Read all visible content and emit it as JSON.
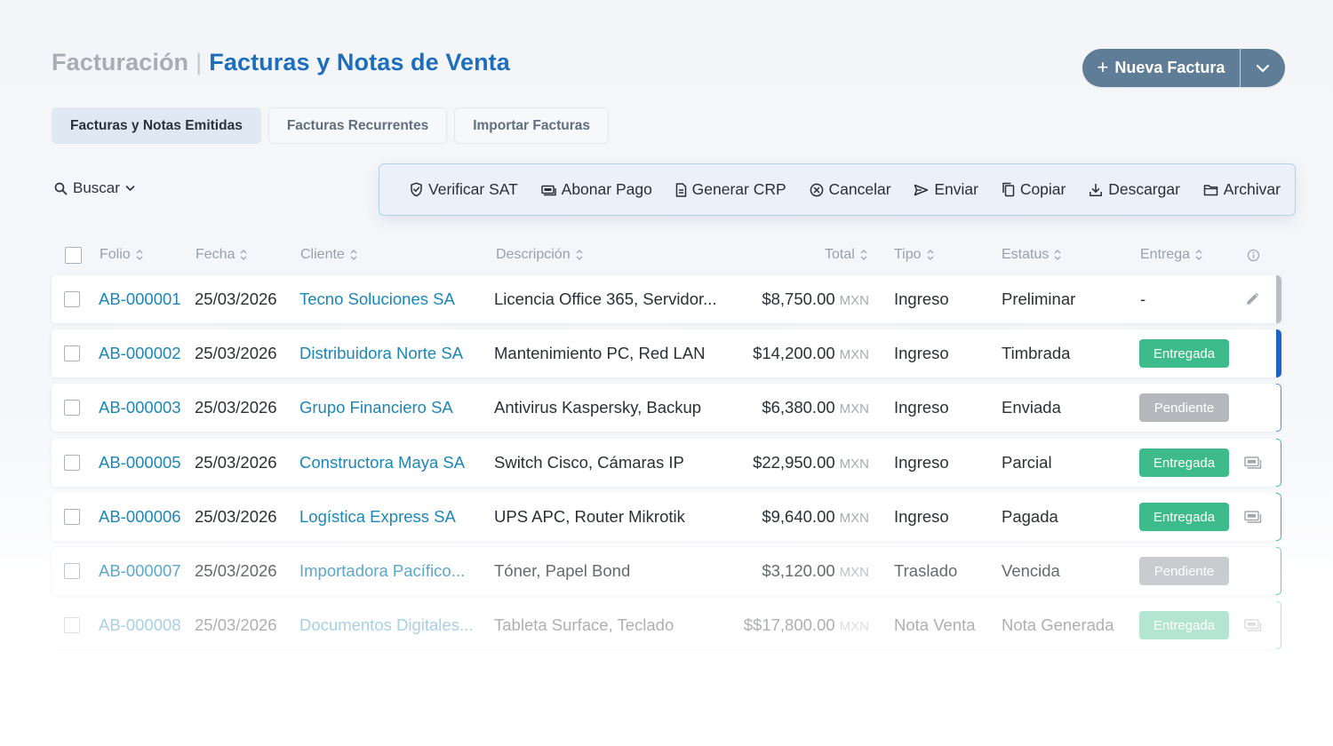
{
  "header": {
    "crumb": "Facturación",
    "separator": "|",
    "title": "Facturas y Notas de Venta",
    "new_button": "Nueva Factura",
    "new_button_icon": "plus-icon",
    "dropdown_icon": "chevron-down-icon"
  },
  "tabs": [
    {
      "label": "Facturas y Notas Emitidas",
      "active": true
    },
    {
      "label": "Facturas Recurrentes",
      "active": false
    },
    {
      "label": "Importar Facturas",
      "active": false
    }
  ],
  "search": {
    "label": "Buscar"
  },
  "toolbar": [
    {
      "label": "Verificar SAT",
      "icon": "shield-check-icon"
    },
    {
      "label": "Abonar Pago",
      "icon": "payment-icon"
    },
    {
      "label": "Generar CRP",
      "icon": "document-icon"
    },
    {
      "label": "Cancelar",
      "icon": "cancel-circle-icon"
    },
    {
      "label": "Enviar",
      "icon": "send-icon"
    },
    {
      "label": "Copiar",
      "icon": "copy-icon"
    },
    {
      "label": "Descargar",
      "icon": "download-icon"
    },
    {
      "label": "Archivar",
      "icon": "folder-icon"
    }
  ],
  "columns": [
    "Folio",
    "Fecha",
    "Cliente",
    "Descripción",
    "Total",
    "Tipo",
    "Estatus",
    "Entrega"
  ],
  "currency": "MXN",
  "rows": [
    {
      "folio": "AB-000001",
      "fecha": "25/03/2026",
      "cliente": "Tecno Soluciones SA",
      "descripcion": "Licencia Office 365, Servidor...",
      "total": "$8,750.00",
      "tipo": "Ingreso",
      "estatus": "Preliminar",
      "entrega": "-",
      "action_icon": "pencil-icon",
      "accent": "#b9bec5"
    },
    {
      "folio": "AB-000002",
      "fecha": "25/03/2026",
      "cliente": "Distribuidora Norte SA",
      "descripcion": "Mantenimiento PC, Red LAN",
      "total": "$14,200.00",
      "tipo": "Ingreso",
      "estatus": "Timbrada",
      "entrega": "Entregada",
      "action_icon": "",
      "accent": "#1d64c8"
    },
    {
      "folio": "AB-000003",
      "fecha": "25/03/2026",
      "cliente": "Grupo Financiero SA",
      "descripcion": "Antivirus Kaspersky, Backup",
      "total": "$6,380.00",
      "tipo": "Ingreso",
      "estatus": "Enviada",
      "entrega": "Pendiente",
      "action_icon": "",
      "accent": "#4c8fd6"
    },
    {
      "folio": "AB-000005",
      "fecha": "25/03/2026",
      "cliente": "Constructora Maya SA",
      "descripcion": "Switch Cisco, Cámaras IP",
      "total": "$22,950.00",
      "tipo": "Ingreso",
      "estatus": "Parcial",
      "entrega": "Entregada",
      "action_icon": "payment-icon",
      "accent": "#3dbb8a"
    },
    {
      "folio": "AB-000006",
      "fecha": "25/03/2026",
      "cliente": "Logística Express SA",
      "descripcion": "UPS APC, Router Mikrotik",
      "total": "$9,640.00",
      "tipo": "Ingreso",
      "estatus": "Pagada",
      "entrega": "Entregada",
      "action_icon": "payment-icon",
      "accent": "#3dbb8a"
    },
    {
      "folio": "AB-000007",
      "fecha": "25/03/2026",
      "cliente": "Importadora Pacífico...",
      "descripcion": "Tóner, Papel Bond",
      "total": "$3,120.00",
      "tipo": "Traslado",
      "estatus": "Vencida",
      "entrega": "Pendiente",
      "action_icon": "",
      "accent": "#3dbb8a"
    },
    {
      "folio": "AB-000008",
      "fecha": "25/03/2026",
      "cliente": "Documentos Digitales...",
      "descripcion": "Tableta Surface, Teclado",
      "total": "$$17,800.00",
      "tipo": "Nota Venta",
      "estatus": "Nota Generada",
      "entrega": "Entregada",
      "action_icon": "payment-icon",
      "accent": "#3dbb8a"
    }
  ]
}
